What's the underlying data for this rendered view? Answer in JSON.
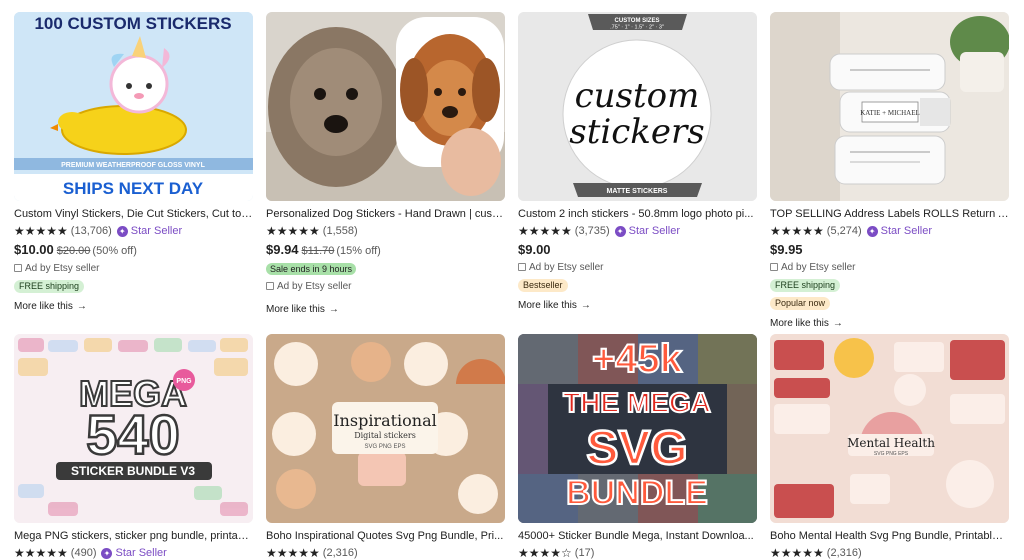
{
  "products": [
    {
      "image": "100-custom-stickers-unicorn",
      "image_text": [
        "100 CUSTOM STICKERS",
        "PREMIUM WEATHERPROOF GLOSS VINYL",
        "SHIPS NEXT DAY"
      ],
      "title": "Custom Vinyl Stickers, Die Cut Stickers, Cut to ...",
      "stars": "★★★★★",
      "reviews": "(13,706)",
      "star_seller": "Star Seller",
      "price": "$10.00",
      "original_price": "$20.00",
      "discount": "(50% off)",
      "ad": "Ad by Etsy seller",
      "badge": "FREE shipping",
      "more": "More like this"
    },
    {
      "image": "personalized-dog-sticker",
      "image_text": [],
      "title": "Personalized Dog Stickers - Hand Drawn | custo...",
      "stars": "★★★★★",
      "reviews": "(1,558)",
      "star_seller": "",
      "price": "$9.94",
      "original_price": "$11.70",
      "discount": "(15% off)",
      "sale": "Sale ends in 9 hours",
      "ad": "Ad by Etsy seller",
      "badge": "",
      "more": "More like this"
    },
    {
      "image": "custom-stickers-roll",
      "image_text": [
        "CUSTOM SIZES",
        ".75\" · 1\" · 1.5\" · 2\" · 3\"",
        "custom",
        "stickers",
        "MATTE STICKERS"
      ],
      "title": "Custom 2 inch stickers - 50.8mm logo photo pi...",
      "stars": "★★★★★",
      "reviews": "(3,735)",
      "star_seller": "Star Seller",
      "price": "$9.00",
      "original_price": "",
      "discount": "",
      "ad": "Ad by Etsy seller",
      "badge": "Bestseller",
      "more": "More like this"
    },
    {
      "image": "address-label-rolls",
      "image_text": [
        "KATIE + MICHAEL"
      ],
      "title": "TOP SELLING Address Labels ROLLS Return Ad...",
      "stars": "★★★★★",
      "reviews": "(5,274)",
      "star_seller": "Star Seller",
      "price": "$9.95",
      "original_price": "",
      "discount": "",
      "ad": "Ad by Etsy seller",
      "badge": "FREE shipping",
      "badge2": "Popular now",
      "more": "More like this"
    },
    {
      "image": "mega-540-sticker-bundle",
      "image_text": [
        "MEGA",
        "540",
        "PNG",
        "STICKER BUNDLE V3"
      ],
      "title": "Mega PNG stickers, sticker png bundle, printab...",
      "stars": "★★★★★",
      "reviews": "(490)",
      "star_seller": "Star Seller"
    },
    {
      "image": "boho-inspirational-quotes",
      "image_text": [
        "Inspirational",
        "Digital stickers",
        "SVG PNG EPS"
      ],
      "title": "Boho Inspirational Quotes Svg Png Bundle, Pri...",
      "stars": "★★★★★",
      "reviews": "(2,316)",
      "star_seller": ""
    },
    {
      "image": "45k-mega-svg-bundle",
      "image_text": [
        "+45k",
        "THE MEGA",
        "SVG",
        "BUNDLE"
      ],
      "title": "45000+ Sticker Bundle Mega, Instant Downloa...",
      "stars": "★★★★☆",
      "reviews": "(17)",
      "star_seller": ""
    },
    {
      "image": "boho-mental-health",
      "image_text": [
        "Mental Health",
        "SVG PNG EPS"
      ],
      "title": "Boho Mental Health Svg Png Bundle, Printable ...",
      "stars": "★★★★★",
      "reviews": "(2,316)",
      "star_seller": ""
    }
  ],
  "colors": {
    "star_seller": "#7b4cc4",
    "free_shipping_bg": "#d4f0d4",
    "bestseller_bg": "#fde9c8",
    "sale_bg": "#a8e0a8"
  }
}
